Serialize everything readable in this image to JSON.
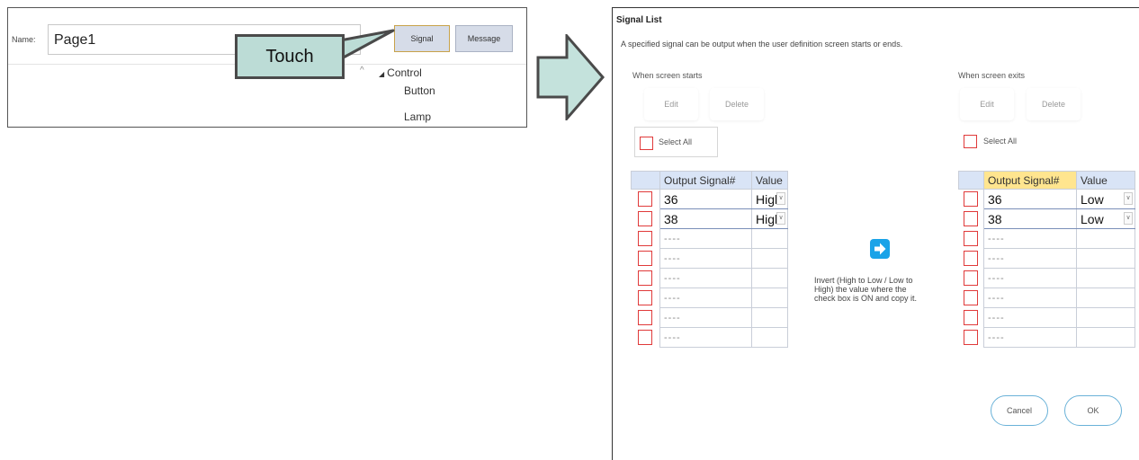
{
  "editor": {
    "name_label": "Name:",
    "name_value": "Page1",
    "signal_button": "Signal",
    "message_button": "Message",
    "tree_caret": "^",
    "tree_control": "Control",
    "tree_items": [
      "Button",
      "Lamp"
    ],
    "callout_text": "Touch"
  },
  "dialog": {
    "title": "Signal List",
    "description": "A specified signal can be output when the user definition screen starts or ends.",
    "left": {
      "heading": "When screen starts",
      "edit": "Edit",
      "delete": "Delete",
      "select_all": "Select All",
      "col_signal": "Output Signal#",
      "col_value": "Value",
      "rows": [
        {
          "signal": "36",
          "value": "High"
        },
        {
          "signal": "38",
          "value": "High"
        },
        {
          "signal": "----",
          "value": ""
        },
        {
          "signal": "----",
          "value": ""
        },
        {
          "signal": "----",
          "value": ""
        },
        {
          "signal": "----",
          "value": ""
        },
        {
          "signal": "----",
          "value": ""
        },
        {
          "signal": "----",
          "value": ""
        }
      ]
    },
    "right": {
      "heading": "When screen exits",
      "edit": "Edit",
      "delete": "Delete",
      "select_all": "Select All",
      "col_signal": "Output Signal#",
      "col_value": "Value",
      "rows": [
        {
          "signal": "36",
          "value": "Low"
        },
        {
          "signal": "38",
          "value": "Low"
        },
        {
          "signal": "----",
          "value": ""
        },
        {
          "signal": "----",
          "value": ""
        },
        {
          "signal": "----",
          "value": ""
        },
        {
          "signal": "----",
          "value": ""
        },
        {
          "signal": "----",
          "value": ""
        },
        {
          "signal": "----",
          "value": ""
        }
      ]
    },
    "invert_text": "Invert (High to Low / Low to High) the value where the check box is ON and copy it.",
    "cancel": "Cancel",
    "ok": "OK"
  },
  "colors": {
    "callout_fill": "#bcdcd6",
    "big_arrow_fill": "#c4e2dc",
    "header_bg": "#d9e4f6",
    "header_highlight": "#ffe58f",
    "checkbox_border": "#e03a3a",
    "copy_button": "#1aa3e8",
    "pill_border": "#6ab2d8"
  },
  "icons": [
    "tree-expand-icon",
    "dropdown-arrow-icon",
    "copy-arrow-icon",
    "big-right-arrow-icon"
  ]
}
